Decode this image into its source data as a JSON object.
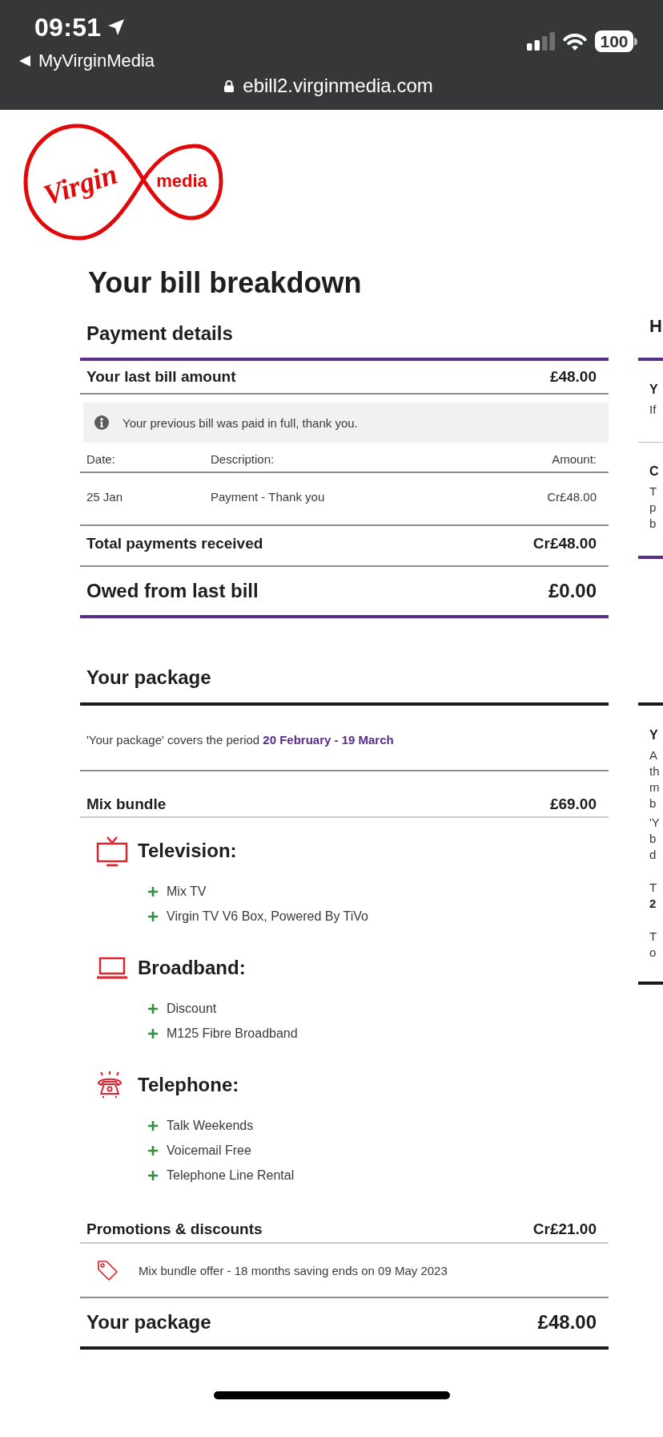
{
  "status_bar": {
    "time": "09:51",
    "back_label": "MyVirginMedia",
    "url": "ebill2.virginmedia.com",
    "battery": "100"
  },
  "logo": {
    "script": "Virgin",
    "wordmark": "media"
  },
  "page_title": "Your bill breakdown",
  "payment_details": {
    "title": "Payment details",
    "last_bill": {
      "label": "Your last bill amount",
      "amount": "£48.00"
    },
    "notice": "Your previous bill was paid in full, thank you.",
    "columns": [
      "Date:",
      "Description:",
      "Amount:"
    ],
    "rows": [
      {
        "date": "25 Jan",
        "description": "Payment - Thank you",
        "amount": "Cr£48.00"
      }
    ],
    "total": {
      "label": "Total payments received",
      "amount": "Cr£48.00"
    },
    "owed": {
      "label": "Owed from last bill",
      "amount": "£0.00"
    }
  },
  "package": {
    "title": "Your package",
    "period": "'Your package' covers the period **20 February - 19 March**",
    "bundle": {
      "label": "Mix bundle",
      "amount": "£69.00"
    },
    "services": [
      {
        "kind": "tv",
        "title": "Television:",
        "items": [
          "Mix TV",
          "Virgin TV V6 Box, Powered By TiVo"
        ]
      },
      {
        "kind": "broadband",
        "title": "Broadband:",
        "items": [
          "Discount",
          "M125 Fibre Broadband"
        ]
      },
      {
        "kind": "telephone",
        "title": "Telephone:",
        "items": [
          "Talk Weekends",
          "Voicemail Free",
          "Telephone Line Rental"
        ]
      }
    ],
    "promotions": {
      "label": "Promotions & discounts",
      "amount": "Cr£21.00",
      "items": [
        "Mix bundle offer - 18 months saving ends on 09 May 2023"
      ]
    },
    "total": {
      "label": "Your package",
      "amount": "£48.00"
    }
  },
  "side_column": {
    "heading": "H",
    "upper_blocks": [
      {
        "title": "Y",
        "lines": [
          "If"
        ]
      },
      {
        "title": "C",
        "lines": [
          "T",
          "p",
          "b"
        ]
      }
    ],
    "lower_block": {
      "title": "Y",
      "paragraphs": [
        [
          {
            "text": "A",
            "bold": false
          },
          {
            "text": "th",
            "bold": false
          },
          {
            "text": "m",
            "bold": false
          },
          {
            "text": "b",
            "bold": false
          }
        ],
        [
          {
            "text": "'Y",
            "bold": false
          },
          {
            "text": "b",
            "bold": false
          },
          {
            "text": "d",
            "bold": false
          }
        ],
        [
          {
            "text": "T",
            "bold": false
          },
          {
            "text": "2",
            "bold": true
          }
        ],
        [
          {
            "text": "T",
            "bold": false
          },
          {
            "text": "o",
            "bold": false
          }
        ]
      ]
    }
  }
}
